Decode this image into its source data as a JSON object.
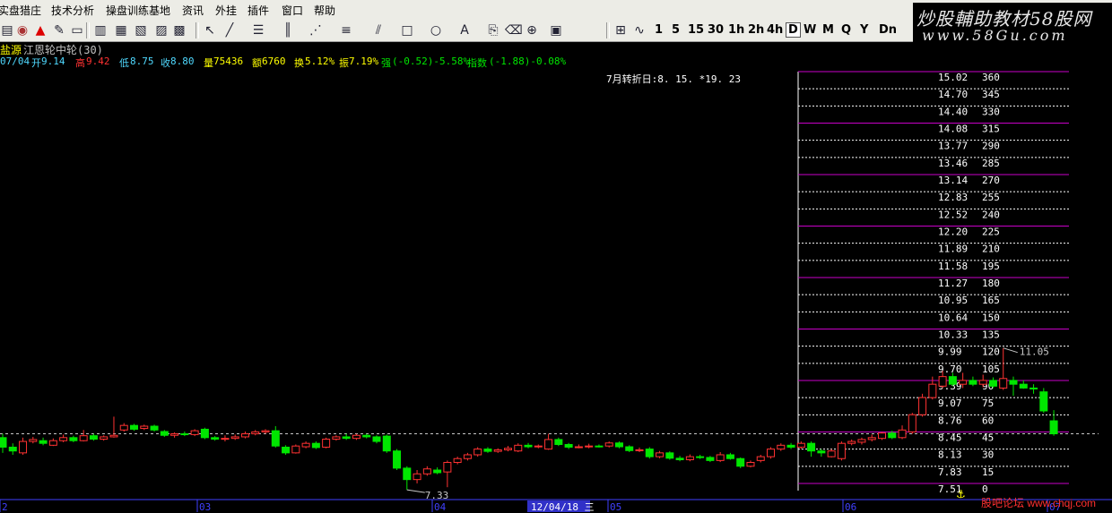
{
  "menubar": {
    "items": [
      "实盘猎庄",
      "技术分析",
      "操盘训练基地",
      "资讯",
      "外挂",
      "插件",
      "窗口",
      "帮助"
    ]
  },
  "toolbar": {
    "periods": [
      "1",
      "5",
      "15",
      "30",
      "1h",
      "2h",
      "4h",
      "D",
      "W",
      "M",
      "Q",
      "Y",
      "Dn"
    ],
    "active_period": "D",
    "icons": [
      "bar-chart-icon",
      "globe-icon",
      "alert-bell-icon",
      "pen-icon",
      "layout-1-icon",
      "layout-2-icon",
      "layout-3-icon",
      "layout-4-icon",
      "layout-5-icon",
      "layout-6-icon",
      "cursor-icon",
      "line-draw-icon",
      "text-tool-icon",
      "parallel-lines-icon",
      "fan-lines-icon",
      "fibonacci-icon",
      "channel-icon",
      "rectangle-icon",
      "ellipse-icon",
      "text-a-icon",
      "copy-icon",
      "eraser-icon",
      "lock-icon",
      "save-icon",
      "gann-box-icon",
      "wave-icon"
    ]
  },
  "watermark": {
    "title": "炒股輔助教材58股网",
    "url": "www.58Gu.com"
  },
  "stock": {
    "exchange_label": "盐源",
    "name": "江恩轮中轮(30)",
    "date": "07/04",
    "open_label": "开",
    "open": "9.14",
    "high_label": "高",
    "high": "9.42",
    "low_label": "低",
    "low": "8.75",
    "close_label": "收",
    "close": "8.80",
    "volume_label": "量",
    "volume": "75436",
    "amount_label": "额",
    "amount": "6760",
    "turnover_label": "换",
    "turnover": "5.12%",
    "amplitude_label": "振",
    "amplitude": "7.19%",
    "strength_label": "强",
    "strength": "(-0.52)-5.58%",
    "index_label": "指数",
    "index": "(-1.88)-0.08%"
  },
  "turning_date": "7月转折日:8. 15. *19. 23",
  "price_min_label": "7.33",
  "price_max_label": "11.05",
  "x_labels": [
    "2",
    "03",
    "04",
    "12/04/18 三",
    "05",
    "06",
    "07"
  ],
  "gann": {
    "prices": [
      "15.02",
      "14.70",
      "14.40",
      "14.08",
      "13.77",
      "13.46",
      "13.14",
      "12.83",
      "12.52",
      "12.20",
      "11.89",
      "11.58",
      "11.27",
      "10.95",
      "10.64",
      "10.33",
      "9.99",
      "9.70",
      "9.39",
      "9.07",
      "8.76",
      "8.45",
      "8.13",
      "7.83",
      "7.51"
    ],
    "degrees": [
      "360",
      "345",
      "330",
      "315",
      "290",
      "285",
      "270",
      "255",
      "240",
      "225",
      "210",
      "195",
      "180",
      "165",
      "150",
      "135",
      "120",
      "105",
      "90",
      "75",
      "60",
      "45",
      "30",
      "15",
      "0"
    ]
  },
  "footer_watermark": "股吧论坛 www.chqj.com",
  "colors": {
    "up": "#ff3232",
    "down": "#00e600",
    "gann_major": "#c800c8",
    "gann_minor": "#ffffff",
    "text_cyan": "#4fd9ff",
    "text_yellow": "#ffff00",
    "price_line": "#c8c8c8"
  },
  "chart_data": {
    "type": "candlestick",
    "y_range": [
      7.35,
      14.9
    ],
    "current_price": 8.8,
    "candles": [
      {
        "o": 8.7,
        "c": 8.45,
        "h": 8.8,
        "l": 8.3
      },
      {
        "o": 8.45,
        "c": 8.35,
        "h": 8.55,
        "l": 8.25
      },
      {
        "o": 8.3,
        "c": 8.6,
        "h": 8.7,
        "l": 8.25
      },
      {
        "o": 8.6,
        "c": 8.65,
        "h": 8.72,
        "l": 8.55
      },
      {
        "o": 8.62,
        "c": 8.55,
        "h": 8.7,
        "l": 8.5
      },
      {
        "o": 8.5,
        "c": 8.62,
        "h": 8.68,
        "l": 8.48
      },
      {
        "o": 8.62,
        "c": 8.7,
        "h": 8.78,
        "l": 8.58
      },
      {
        "o": 8.7,
        "c": 8.62,
        "h": 8.75,
        "l": 8.58
      },
      {
        "o": 8.62,
        "c": 8.75,
        "h": 8.9,
        "l": 8.6
      },
      {
        "o": 8.75,
        "c": 8.66,
        "h": 8.8,
        "l": 8.62
      },
      {
        "o": 8.66,
        "c": 8.72,
        "h": 8.76,
        "l": 8.62
      },
      {
        "o": 8.72,
        "c": 8.76,
        "h": 9.25,
        "l": 8.7
      },
      {
        "o": 8.9,
        "c": 9.02,
        "h": 9.08,
        "l": 8.86
      },
      {
        "o": 9.02,
        "c": 8.92,
        "h": 9.06,
        "l": 8.88
      },
      {
        "o": 8.94,
        "c": 9.0,
        "h": 9.04,
        "l": 8.9
      },
      {
        "o": 9.0,
        "c": 8.9,
        "h": 9.04,
        "l": 8.86
      },
      {
        "o": 8.86,
        "c": 8.76,
        "h": 8.9,
        "l": 8.72
      },
      {
        "o": 8.76,
        "c": 8.8,
        "h": 8.84,
        "l": 8.7
      },
      {
        "o": 8.8,
        "c": 8.78,
        "h": 8.86,
        "l": 8.74
      },
      {
        "o": 8.78,
        "c": 8.88,
        "h": 8.92,
        "l": 8.74
      },
      {
        "o": 8.92,
        "c": 8.7,
        "h": 8.96,
        "l": 8.66
      },
      {
        "o": 8.7,
        "c": 8.66,
        "h": 8.74,
        "l": 8.62
      },
      {
        "o": 8.66,
        "c": 8.68,
        "h": 8.76,
        "l": 8.6
      },
      {
        "o": 8.68,
        "c": 8.72,
        "h": 8.78,
        "l": 8.64
      },
      {
        "o": 8.72,
        "c": 8.8,
        "h": 8.86,
        "l": 8.68
      },
      {
        "o": 8.8,
        "c": 8.85,
        "h": 8.9,
        "l": 8.76
      },
      {
        "o": 8.85,
        "c": 8.88,
        "h": 8.92,
        "l": 8.8
      },
      {
        "o": 8.88,
        "c": 8.48,
        "h": 9.0,
        "l": 8.44
      },
      {
        "o": 8.45,
        "c": 8.3,
        "h": 8.5,
        "l": 8.25
      },
      {
        "o": 8.3,
        "c": 8.48,
        "h": 8.52,
        "l": 8.28
      },
      {
        "o": 8.46,
        "c": 8.55,
        "h": 8.6,
        "l": 8.42
      },
      {
        "o": 8.55,
        "c": 8.44,
        "h": 8.6,
        "l": 8.4
      },
      {
        "o": 8.45,
        "c": 8.66,
        "h": 8.7,
        "l": 8.42
      },
      {
        "o": 8.66,
        "c": 8.72,
        "h": 8.76,
        "l": 8.62
      },
      {
        "o": 8.72,
        "c": 8.68,
        "h": 8.8,
        "l": 8.64
      },
      {
        "o": 8.68,
        "c": 8.76,
        "h": 8.8,
        "l": 8.64
      },
      {
        "o": 8.76,
        "c": 8.72,
        "h": 8.8,
        "l": 8.68
      },
      {
        "o": 8.72,
        "c": 8.6,
        "h": 8.76,
        "l": 8.55
      },
      {
        "o": 8.74,
        "c": 8.35,
        "h": 8.78,
        "l": 8.3
      },
      {
        "o": 8.35,
        "c": 7.9,
        "h": 8.4,
        "l": 7.85
      },
      {
        "o": 7.9,
        "c": 7.6,
        "h": 7.95,
        "l": 7.33
      },
      {
        "o": 7.6,
        "c": 7.75,
        "h": 7.85,
        "l": 7.5
      },
      {
        "o": 7.75,
        "c": 7.88,
        "h": 7.95,
        "l": 7.7
      },
      {
        "o": 7.85,
        "c": 7.78,
        "h": 7.92,
        "l": 7.74
      },
      {
        "o": 7.8,
        "c": 8.05,
        "h": 8.1,
        "l": 7.4
      },
      {
        "o": 8.05,
        "c": 8.15,
        "h": 8.2,
        "l": 8.0
      },
      {
        "o": 8.15,
        "c": 8.25,
        "h": 8.3,
        "l": 8.1
      },
      {
        "o": 8.25,
        "c": 8.4,
        "h": 8.45,
        "l": 8.2
      },
      {
        "o": 8.4,
        "c": 8.34,
        "h": 8.45,
        "l": 8.3
      },
      {
        "o": 8.34,
        "c": 8.38,
        "h": 8.42,
        "l": 8.3
      },
      {
        "o": 8.38,
        "c": 8.42,
        "h": 8.48,
        "l": 8.34
      },
      {
        "o": 8.35,
        "c": 8.5,
        "h": 8.55,
        "l": 8.32
      },
      {
        "o": 8.5,
        "c": 8.46,
        "h": 8.56,
        "l": 8.42
      },
      {
        "o": 8.46,
        "c": 8.48,
        "h": 8.52,
        "l": 8.42
      },
      {
        "o": 8.4,
        "c": 8.65,
        "h": 8.8,
        "l": 8.38
      },
      {
        "o": 8.65,
        "c": 8.52,
        "h": 8.7,
        "l": 8.48
      },
      {
        "o": 8.52,
        "c": 8.45,
        "h": 8.56,
        "l": 8.4
      },
      {
        "o": 8.45,
        "c": 8.46,
        "h": 8.52,
        "l": 8.42
      },
      {
        "o": 8.46,
        "c": 8.48,
        "h": 8.54,
        "l": 8.42
      },
      {
        "o": 8.48,
        "c": 8.47,
        "h": 8.52,
        "l": 8.44
      },
      {
        "o": 8.48,
        "c": 8.56,
        "h": 8.6,
        "l": 8.44
      },
      {
        "o": 8.56,
        "c": 8.46,
        "h": 8.6,
        "l": 8.42
      },
      {
        "o": 8.46,
        "c": 8.36,
        "h": 8.5,
        "l": 8.32
      },
      {
        "o": 8.36,
        "c": 8.38,
        "h": 8.44,
        "l": 8.32
      },
      {
        "o": 8.4,
        "c": 8.2,
        "h": 8.45,
        "l": 8.15
      },
      {
        "o": 8.2,
        "c": 8.3,
        "h": 8.35,
        "l": 8.16
      },
      {
        "o": 8.3,
        "c": 8.16,
        "h": 8.34,
        "l": 8.12
      },
      {
        "o": 8.16,
        "c": 8.12,
        "h": 8.22,
        "l": 8.08
      },
      {
        "o": 8.12,
        "c": 8.2,
        "h": 8.26,
        "l": 8.08
      },
      {
        "o": 8.2,
        "c": 8.18,
        "h": 8.25,
        "l": 8.14
      },
      {
        "o": 8.18,
        "c": 8.1,
        "h": 8.22,
        "l": 8.06
      },
      {
        "o": 8.1,
        "c": 8.25,
        "h": 8.32,
        "l": 8.06
      },
      {
        "o": 8.25,
        "c": 8.15,
        "h": 8.3,
        "l": 8.12
      },
      {
        "o": 8.15,
        "c": 7.95,
        "h": 8.18,
        "l": 7.9
      },
      {
        "o": 7.95,
        "c": 8.05,
        "h": 8.1,
        "l": 7.92
      },
      {
        "o": 8.1,
        "c": 8.2,
        "h": 8.25,
        "l": 8.05
      },
      {
        "o": 8.2,
        "c": 8.4,
        "h": 8.45,
        "l": 8.15
      },
      {
        "o": 8.4,
        "c": 8.5,
        "h": 8.55,
        "l": 8.35
      },
      {
        "o": 8.5,
        "c": 8.45,
        "h": 8.56,
        "l": 8.4
      },
      {
        "o": 8.45,
        "c": 8.55,
        "h": 8.6,
        "l": 8.4
      },
      {
        "o": 8.55,
        "c": 8.35,
        "h": 8.6,
        "l": 8.2
      },
      {
        "o": 8.35,
        "c": 8.3,
        "h": 8.4,
        "l": 8.2
      },
      {
        "o": 8.2,
        "c": 8.35,
        "h": 8.4,
        "l": 8.18
      },
      {
        "o": 8.15,
        "c": 8.55,
        "h": 8.6,
        "l": 8.1
      },
      {
        "o": 8.55,
        "c": 8.6,
        "h": 8.65,
        "l": 8.5
      },
      {
        "o": 8.58,
        "c": 8.65,
        "h": 8.7,
        "l": 8.52
      },
      {
        "o": 8.65,
        "c": 8.7,
        "h": 8.78,
        "l": 8.6
      },
      {
        "o": 8.68,
        "c": 8.82,
        "h": 8.85,
        "l": 8.64
      },
      {
        "o": 8.82,
        "c": 8.7,
        "h": 8.88,
        "l": 8.66
      },
      {
        "o": 8.7,
        "c": 8.9,
        "h": 9.02,
        "l": 8.66
      },
      {
        "o": 8.85,
        "c": 9.3,
        "h": 9.35,
        "l": 8.8
      },
      {
        "o": 9.3,
        "c": 9.75,
        "h": 9.85,
        "l": 9.25
      },
      {
        "o": 9.75,
        "c": 10.1,
        "h": 10.3,
        "l": 9.7
      },
      {
        "o": 10.05,
        "c": 10.3,
        "h": 10.45,
        "l": 10.0
      },
      {
        "o": 10.3,
        "c": 10.1,
        "h": 10.4,
        "l": 10.05
      },
      {
        "o": 10.1,
        "c": 10.2,
        "h": 10.4,
        "l": 10.0
      },
      {
        "o": 10.2,
        "c": 10.1,
        "h": 10.3,
        "l": 10.05
      },
      {
        "o": 10.1,
        "c": 10.2,
        "h": 10.35,
        "l": 10.02
      },
      {
        "o": 10.2,
        "c": 10.05,
        "h": 10.28,
        "l": 10.0
      },
      {
        "o": 10.0,
        "c": 10.25,
        "h": 11.05,
        "l": 9.95
      },
      {
        "o": 10.2,
        "c": 10.1,
        "h": 10.3,
        "l": 9.8
      },
      {
        "o": 10.1,
        "c": 10.0,
        "h": 10.2,
        "l": 9.98
      },
      {
        "o": 10.0,
        "c": 9.98,
        "h": 10.1,
        "l": 9.85
      },
      {
        "o": 9.9,
        "c": 9.4,
        "h": 10.0,
        "l": 9.35
      },
      {
        "o": 9.14,
        "c": 8.8,
        "h": 9.42,
        "l": 8.75
      }
    ]
  }
}
